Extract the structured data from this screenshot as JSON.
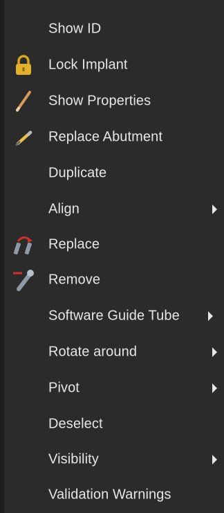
{
  "menu": {
    "items": [
      {
        "label": "Show ID",
        "icon": null,
        "submenu": false
      },
      {
        "label": "Lock Implant",
        "icon": "lock-icon",
        "submenu": false
      },
      {
        "label": "Show Properties",
        "icon": "pencil-icon",
        "submenu": false
      },
      {
        "label": "Replace Abutment",
        "icon": "pencil-abutment-icon",
        "submenu": false
      },
      {
        "label": "Duplicate",
        "icon": null,
        "submenu": false
      },
      {
        "label": "Align",
        "icon": null,
        "submenu": true
      },
      {
        "label": "Replace",
        "icon": "replace-implant-icon",
        "submenu": false
      },
      {
        "label": "Remove",
        "icon": "remove-implant-icon",
        "submenu": false
      },
      {
        "label": "Software Guide Tube",
        "icon": null,
        "submenu": true
      },
      {
        "label": "Rotate around",
        "icon": null,
        "submenu": true
      },
      {
        "label": "Pivot",
        "icon": null,
        "submenu": true
      },
      {
        "label": "Deselect",
        "icon": null,
        "submenu": false
      },
      {
        "label": "Visibility",
        "icon": null,
        "submenu": true
      },
      {
        "label": "Validation Warnings",
        "icon": null,
        "submenu": false
      }
    ]
  },
  "colors": {
    "background": "#2b2b2b",
    "text": "#e6e6e6",
    "lock": "#e2b12a",
    "pencil": "#d79a58",
    "red_accent": "#d0302b",
    "metal": "#8f9aa7"
  }
}
